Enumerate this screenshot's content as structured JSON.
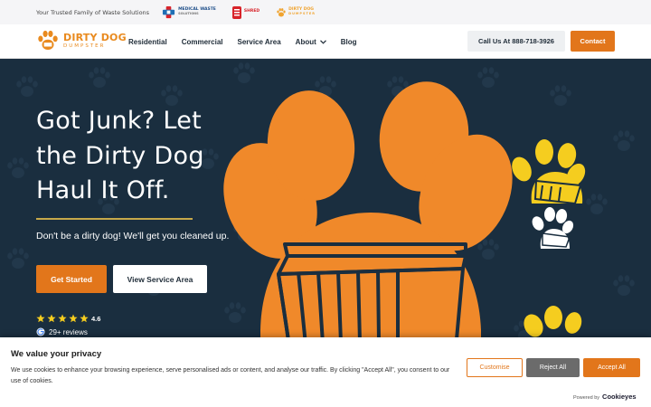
{
  "topstrip": {
    "tagline": "Your Trusted Family of Waste Solutions",
    "partners": [
      {
        "line1": "MEDICAL WASTE",
        "line2": "SOLUTIONS"
      },
      {
        "line1": "",
        "line2": "SHRED"
      },
      {
        "line1": "DIRTY DOG",
        "line2": "DUMPSTER"
      }
    ]
  },
  "nav": {
    "logo_line1": "DIRTY DOG",
    "logo_line2": "DUMPSTER",
    "links": [
      "Residential",
      "Commercial",
      "Service Area",
      "About",
      "Blog"
    ],
    "call_label": "Call Us At 888-718-3926",
    "contact_label": "Contact"
  },
  "hero": {
    "headline_lines": [
      "Got Junk? Let",
      "the Dirty Dog",
      "Haul It Off."
    ],
    "subheadline": "Don't be a dirty dog! We'll get you cleaned up.",
    "primary_button": "Get Started",
    "secondary_button": "View Service Area",
    "rating": "4.6",
    "stars": 5,
    "reviews": "29+ reviews"
  },
  "cookie": {
    "title": "We value your privacy",
    "text": "We use cookies to enhance your browsing experience, serve personalised ads or content, and analyse our traffic. By clicking \"Accept All\", you consent to our use of cookies.",
    "customise": "Customise",
    "reject": "Reject All",
    "accept": "Accept All",
    "powered_by": "Powered by",
    "powered_brand": "Cookieyes"
  },
  "colors": {
    "accent": "#e2761b",
    "hero_bg": "#1a2e3f",
    "paw_yellow": "#f5cd1f"
  }
}
